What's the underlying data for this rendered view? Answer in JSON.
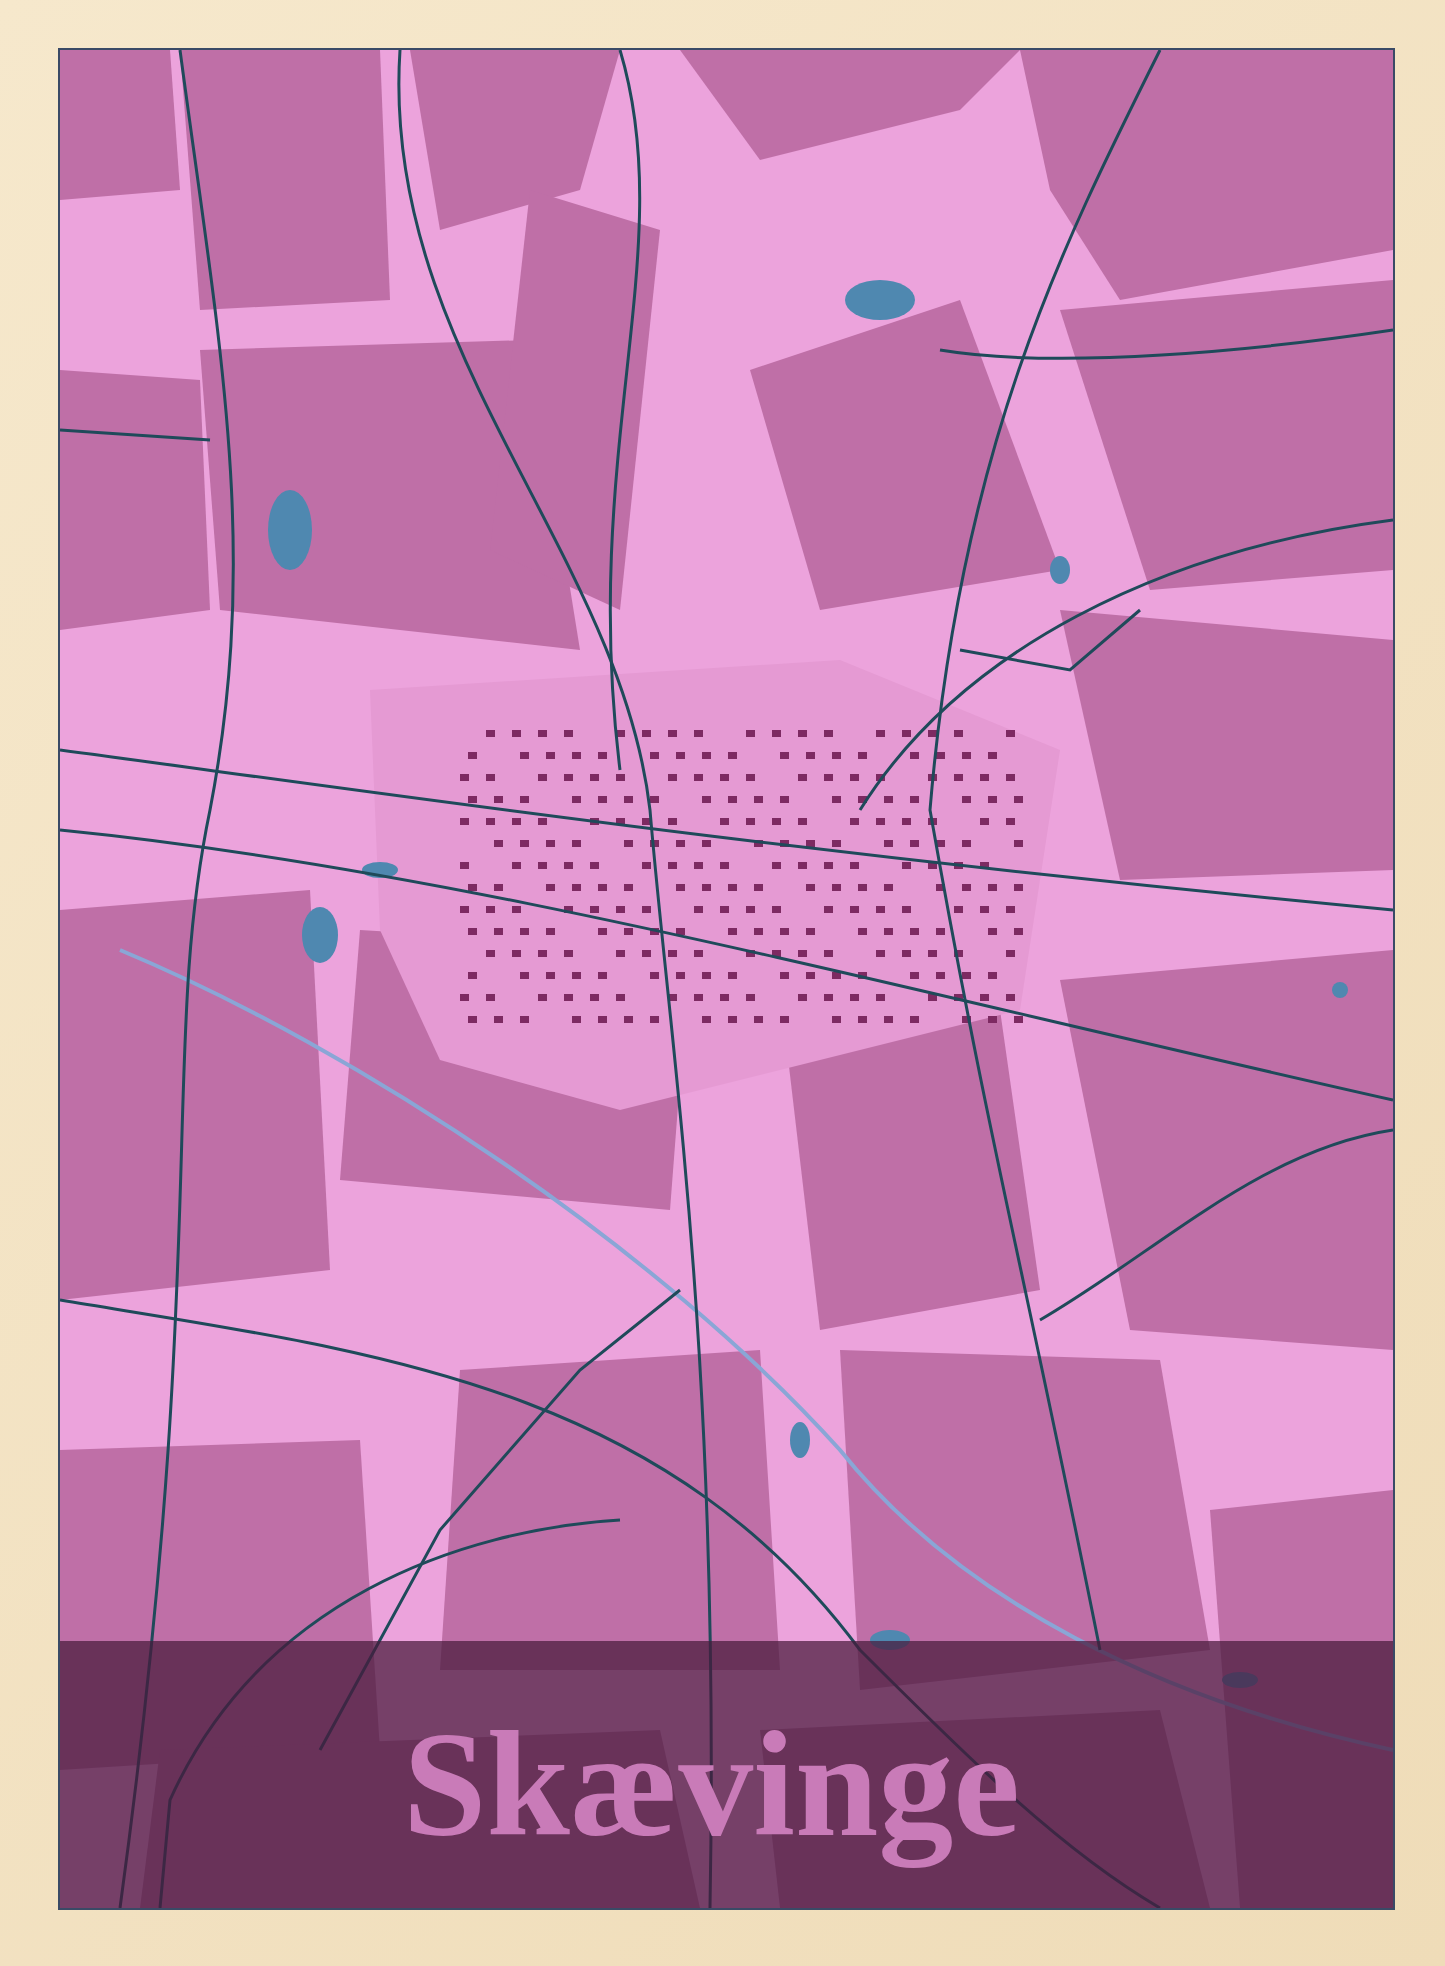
{
  "poster": {
    "title": "Skævinge"
  }
}
